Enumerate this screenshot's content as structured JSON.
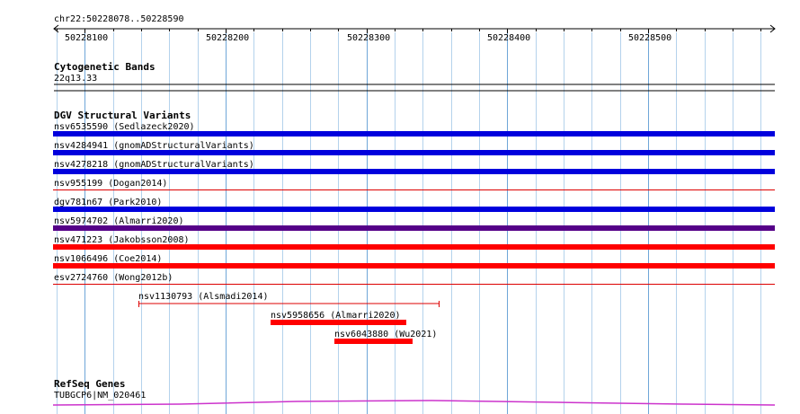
{
  "ruler": {
    "location": "chr22:50228078..50228590",
    "ticks": [
      "50228100",
      "50228200",
      "50228300",
      "50228400",
      "50228500"
    ]
  },
  "tracks": {
    "cytobands": {
      "title": "Cytogenetic Bands",
      "band": "22q13.33"
    },
    "dgv": {
      "title": "DGV Structural Variants",
      "full_rows": [
        {
          "label": "nsv6535590 (Sedlazeck2020)",
          "color": "#0000dd",
          "style": "thick"
        },
        {
          "label": "nsv4284941 (gnomADStructuralVariants)",
          "color": "#0000dd",
          "style": "thick"
        },
        {
          "label": "nsv4278218 (gnomADStructuralVariants)",
          "color": "#0000dd",
          "style": "thick"
        },
        {
          "label": "nsv955199 (Dogan2014)",
          "color": "#dd0000",
          "style": "thin"
        },
        {
          "label": "dgv781n67 (Park2010)",
          "color": "#0000dd",
          "style": "thick"
        },
        {
          "label": "nsv5974702 (Almarri2020)",
          "color": "#550088",
          "style": "thick"
        },
        {
          "label": "nsv471223 (Jakobsson2008)",
          "color": "#ff0000",
          "style": "thick"
        },
        {
          "label": "nsv1066496 (Coe2014)",
          "color": "#ff0000",
          "style": "thick"
        },
        {
          "label": "esv2724760 (Wong2012b)",
          "color": "#dd0000",
          "style": "thin"
        }
      ],
      "partial_rows": [
        {
          "label": "nsv1130793 (Alsmadi2014)",
          "start": 50228138,
          "end": 50228352,
          "color": "#dd0000",
          "style": "thin"
        },
        {
          "label": "nsv5958656 (Almarri2020)",
          "start": 50228232,
          "end": 50228328,
          "color": "#ff0000",
          "style": "thick"
        },
        {
          "label": "nsv6043880 (Wu2021)",
          "start": 50228277,
          "end": 50228333,
          "color": "#ff0000",
          "style": "thick"
        }
      ]
    },
    "refseq": {
      "title": "RefSeq Genes",
      "gene": "TUBGCP6|NM_020461",
      "color": "#cc33cc"
    }
  }
}
